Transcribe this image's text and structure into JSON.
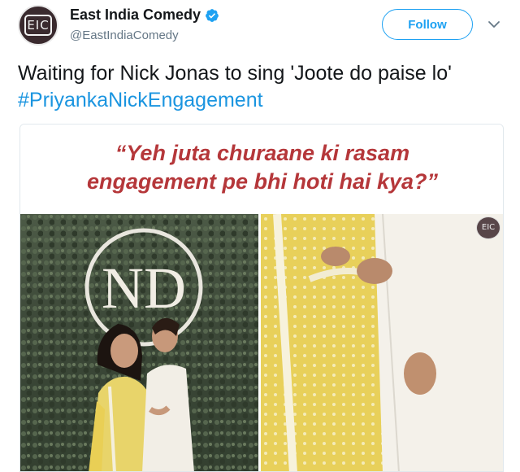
{
  "account": {
    "display_name": "East India Comedy",
    "handle": "@EastIndiaComedy",
    "avatar_logo": "EIC"
  },
  "follow_button": {
    "label": "Follow"
  },
  "tweet": {
    "text": "Waiting for Nick Jonas to sing 'Joote do paise lo' ",
    "hashtag": "#PriyankaNickEngagement"
  },
  "media": {
    "quote_line_1": "“Yeh juta churaane ki rasam",
    "quote_line_2": "engagement pe bhi hoti hai kya?”",
    "monogram": "ND",
    "watermark": "EIC"
  },
  "colors": {
    "hashtag": "#1b95e0",
    "follow_accent": "#1da1f2",
    "quote_red": "#b5373a",
    "verified_blue": "#1da1f2"
  },
  "icons": [
    "verified-badge-icon",
    "chevron-down-icon"
  ]
}
